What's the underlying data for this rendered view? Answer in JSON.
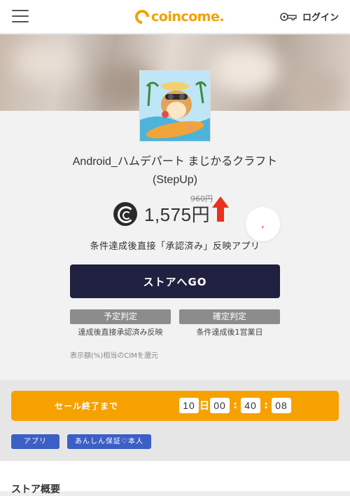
{
  "header": {
    "logo_text": "coincome.",
    "login_label": "ログイン"
  },
  "app": {
    "title": "Android_ハムデパート まじかるクラフト(StepUp)",
    "old_price": "960円",
    "price": "1,575円",
    "bubble_text": ",",
    "subtitle": "条件達成後直接「承認済み」反映アプリ",
    "go_button_label": "ストアへGO"
  },
  "judgement": {
    "scheduled": {
      "badge": "予定判定",
      "desc": "達成後直接承認済み反映"
    },
    "confirmed": {
      "badge": "確定判定",
      "desc": "条件達成後1営業日"
    }
  },
  "note": "表示額(%)相当のCIMを還元",
  "sale": {
    "label": "セール終了まで",
    "days": "10",
    "day_unit": "日",
    "hours": "00",
    "minutes": "40",
    "seconds": "08",
    "separator": ":"
  },
  "tags": [
    "アプリ",
    "あんしん保証♡本人"
  ],
  "section": {
    "overview_title": "ストア概要"
  },
  "colors": {
    "brand": "#f5a000",
    "go_button": "#202040",
    "sale_bar": "#f7a100",
    "tag": "#3b5fc4",
    "up_arrow": "#e8321e"
  }
}
